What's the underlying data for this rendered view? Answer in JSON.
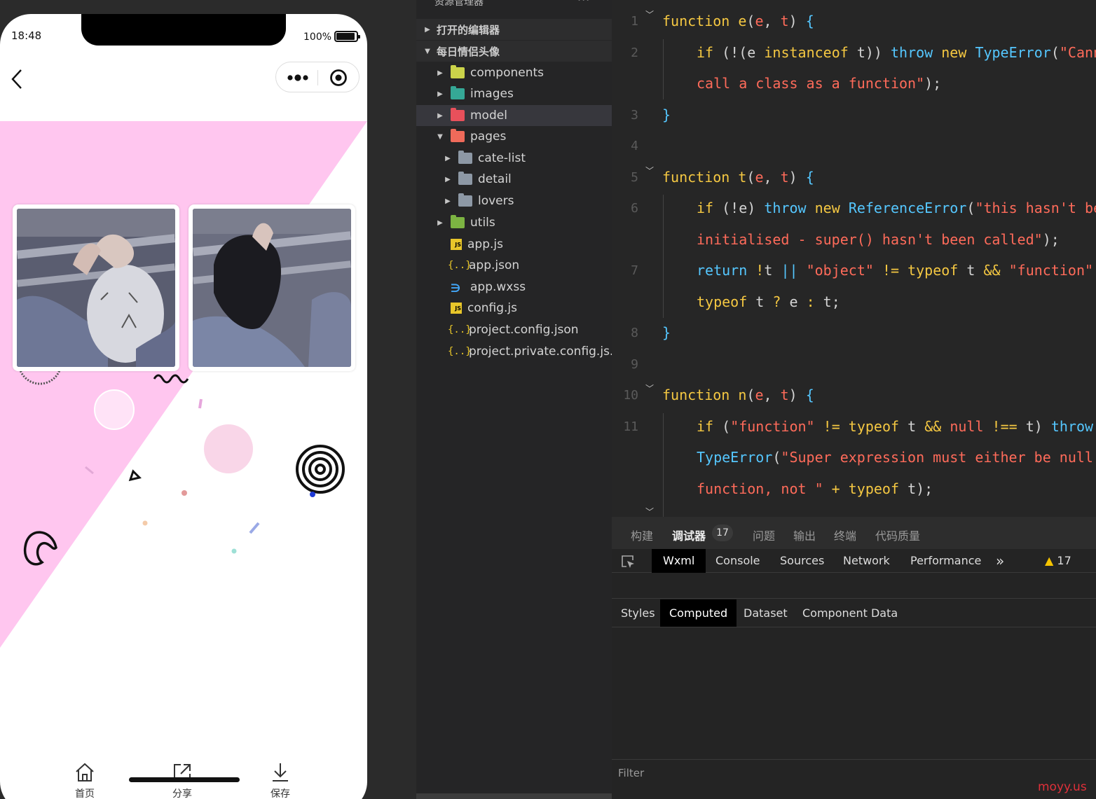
{
  "simulator": {
    "status_time": "18:48",
    "battery_text": "100%",
    "tabbar": [
      {
        "label": "首页",
        "icon": "home-icon"
      },
      {
        "label": "分享",
        "icon": "share-icon"
      },
      {
        "label": "保存",
        "icon": "download-icon"
      }
    ],
    "colors": {
      "poster_pink": "#ffc6ef",
      "background": "#ffffff"
    }
  },
  "explorer": {
    "header": "资源管理器",
    "more": "···",
    "sections": [
      {
        "label": "打开的编辑器",
        "expanded": false
      },
      {
        "label": "每日情侣头像",
        "expanded": true
      }
    ],
    "tree": [
      {
        "label": "components",
        "type": "folder",
        "color": "#cbd34a"
      },
      {
        "label": "images",
        "type": "folder",
        "color": "#35a896"
      },
      {
        "label": "model",
        "type": "folder",
        "color": "#e8505b",
        "selected": true
      },
      {
        "label": "pages",
        "type": "folder",
        "color": "#ef6a5a",
        "expanded": true
      },
      {
        "label": "cate-list",
        "type": "folder",
        "color": "#8d98a5"
      },
      {
        "label": "detail",
        "type": "folder",
        "color": "#8d98a5"
      },
      {
        "label": "lovers",
        "type": "folder",
        "color": "#8d98a5"
      },
      {
        "label": "utils",
        "type": "folder",
        "color": "#7cb342"
      },
      {
        "label": "app.js",
        "type": "js"
      },
      {
        "label": "app.json",
        "type": "json"
      },
      {
        "label": "app.wxss",
        "type": "wxss"
      },
      {
        "label": "config.js",
        "type": "js"
      },
      {
        "label": "project.config.json",
        "type": "json"
      },
      {
        "label": "project.private.config.js...",
        "type": "json"
      }
    ]
  },
  "editor": {
    "line_numbers": [
      "1",
      "2",
      "3",
      "4",
      "5",
      "6",
      "7",
      "8",
      "9",
      "10",
      "11"
    ]
  },
  "devtools": {
    "top_tabs": [
      "构建",
      "调试器",
      "问题",
      "输出",
      "终端",
      "代码质量"
    ],
    "debugger_badge": "17",
    "tabs": [
      "Wxml",
      "Console",
      "Sources",
      "Network",
      "Performance"
    ],
    "more": "»",
    "warning_count": "17",
    "sub_tabs": [
      "Styles",
      "Computed",
      "Dataset",
      "Component Data"
    ],
    "filter_placeholder": "Filter",
    "watermark": "moyy.us"
  }
}
